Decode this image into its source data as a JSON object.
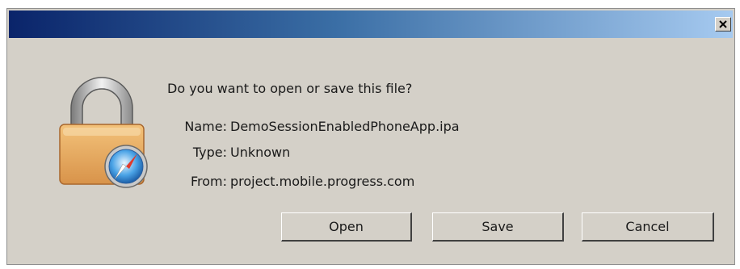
{
  "dialog": {
    "title": "",
    "question": "Do you want to open or save this file?",
    "fields": {
      "name_label": "Name:",
      "name_value": "DemoSessionEnabledPhoneApp.ipa",
      "type_label": "Type:",
      "type_value": "Unknown",
      "from_label": "From:",
      "from_value": "project.mobile.progress.com"
    },
    "buttons": {
      "open": "Open",
      "save": "Save",
      "cancel": "Cancel"
    },
    "icons": {
      "close": "close-icon",
      "file": "padlock-compass-icon"
    },
    "colors": {
      "titlebar_start": "#0a246a",
      "titlebar_end": "#a6caf0",
      "dialog_bg": "#d4d0c8"
    }
  }
}
